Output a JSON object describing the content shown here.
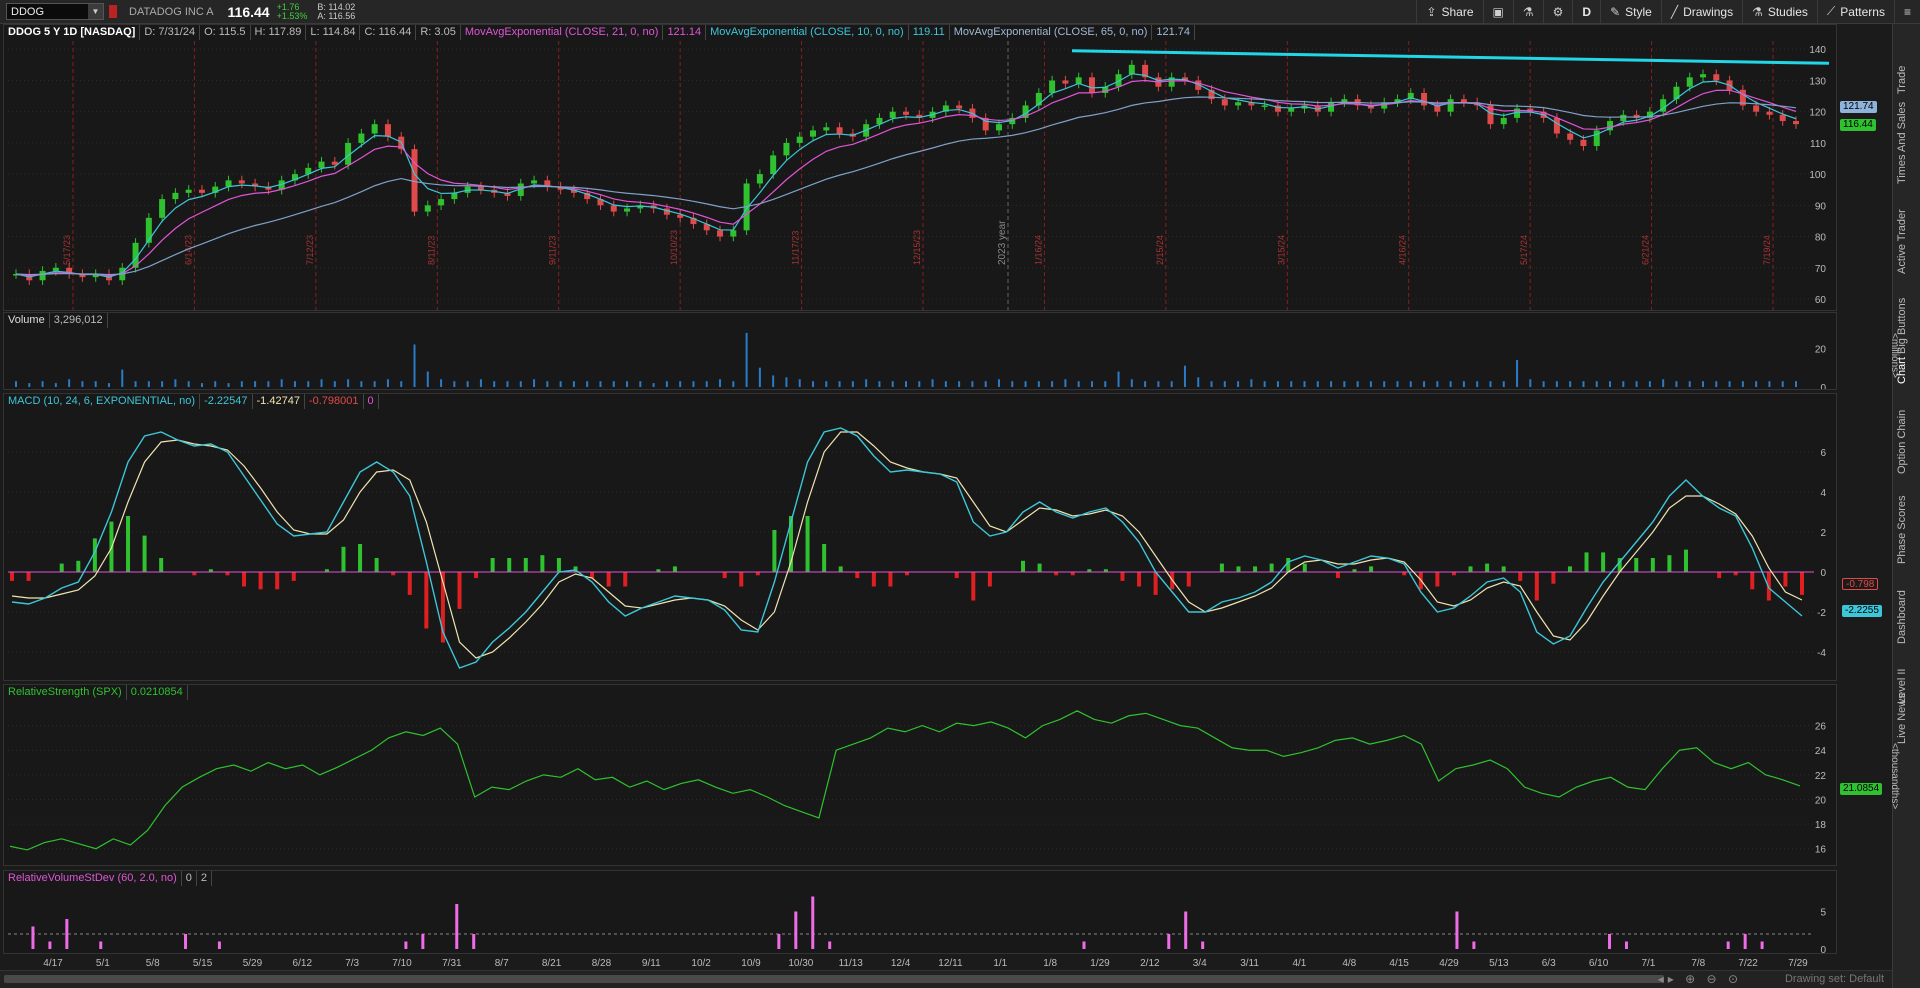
{
  "toolbar": {
    "symbol": "DDOG",
    "company": "DATADOG INC A",
    "last": "116.44",
    "change": "+1.76",
    "change_pct": "+1.53%",
    "bid": "B: 114.02",
    "ask": "A: 116.56",
    "share": "Share",
    "period": "D",
    "style": "Style",
    "drawings": "Drawings",
    "studies": "Studies",
    "patterns": "Patterns"
  },
  "side_tabs": [
    "Trade",
    "Times And Sales",
    "Active Trader",
    "Big Buttons",
    "Chart",
    "Option Chain",
    "Phase Scores",
    "Dashboard",
    "Level II",
    "Live News"
  ],
  "price_panel": {
    "header": "DDOG 5 Y 1D [NASDAQ]",
    "ohlc": {
      "d": "D: 7/31/24",
      "o": "O: 115.5",
      "h": "H: 117.89",
      "l": "L: 114.84",
      "c": "C: 116.44",
      "r": "R: 3.05"
    },
    "ema21_label": "MovAvgExponential (CLOSE, 21, 0, no)",
    "ema21_val": "121.14",
    "ema10_label": "MovAvgExponential (CLOSE, 10, 0, no)",
    "ema10_val": "119.11",
    "ema65_label": "MovAvgExponential (CLOSE, 65, 0, no)",
    "ema65_val": "121.74",
    "last_bubble": "116.44",
    "ema_bubble": "121.74",
    "year_marker": "2023 year",
    "colors": {
      "up": "#2fc12f",
      "down": "#e04a4a",
      "ema10": "#3cc6d8",
      "ema21": "#e155d7",
      "ema65": "#7fa1c8",
      "trendline": "#23d6e6"
    }
  },
  "volume_panel": {
    "label": "Volume",
    "value": "3,296,012",
    "unit": "<millions>"
  },
  "macd_panel": {
    "label": "MACD (10, 24, 6, EXPONENTIAL, no)",
    "value": "-2.22547",
    "avg": "-1.42747",
    "diff": "-0.798001",
    "zero": "0",
    "bubble_diff": "-0.798",
    "bubble_value": "-2.2255"
  },
  "rs_panel": {
    "label": "RelativeStrength (SPX)",
    "value": "0.0210854",
    "bubble": "21.0854",
    "unit": "<thousandths>"
  },
  "rv_panel": {
    "label": "RelativeVolumeStDev (60, 2.0, no)",
    "value": "0",
    "threshold": "2"
  },
  "x_axis": [
    "4/17",
    "5/1",
    "5/8",
    "5/15",
    "5/29",
    "6/12",
    "7/3",
    "7/10",
    "7/31",
    "8/7",
    "8/21",
    "8/28",
    "9/11",
    "10/2",
    "10/9",
    "10/30",
    "11/13",
    "12/4",
    "12/11",
    "1/1",
    "1/8",
    "1/29",
    "2/12",
    "3/4",
    "3/11",
    "4/1",
    "4/8",
    "4/15",
    "4/29",
    "5/13",
    "6/3",
    "6/10",
    "7/1",
    "7/8",
    "7/22",
    "7/29"
  ],
  "date_markers": [
    "5/17/23",
    "6/14/23",
    "7/12/23",
    "8/11/23",
    "9/11/23",
    "10/10/23",
    "11/17/23",
    "12/15/23",
    "1/16/24",
    "2/15/24",
    "3/15/24",
    "4/16/24",
    "5/17/24",
    "6/21/24",
    "7/19/24"
  ],
  "price_ticks": [
    "140",
    "130",
    "120",
    "110",
    "100",
    "90",
    "80",
    "70",
    "60"
  ],
  "volume_ticks": [
    "20",
    "0"
  ],
  "macd_ticks": [
    "6",
    "4",
    "2",
    "0",
    "-2",
    "-4"
  ],
  "rs_ticks": [
    "26",
    "24",
    "22",
    "20",
    "18",
    "16"
  ],
  "rv_ticks": [
    "5",
    "0"
  ],
  "chart_data": {
    "type": "line",
    "price_closes": [
      68,
      66,
      69,
      70,
      68,
      67,
      68,
      66,
      70,
      78,
      86,
      92,
      94,
      95,
      94,
      96,
      98,
      97,
      96,
      95,
      98,
      100,
      102,
      104,
      103,
      110,
      113,
      116,
      112,
      108,
      88,
      90,
      92,
      94,
      96,
      95,
      94,
      93,
      97,
      98,
      96,
      95,
      94,
      92,
      90,
      88,
      89,
      90,
      89,
      87,
      86,
      84,
      82,
      80,
      82,
      97,
      100,
      106,
      110,
      112,
      114,
      115,
      113,
      112,
      116,
      118,
      120,
      119,
      118,
      120,
      122,
      121,
      118,
      114,
      116,
      118,
      122,
      126,
      130,
      129,
      131,
      126,
      128,
      132,
      135,
      131,
      128,
      131,
      130,
      127,
      124,
      122,
      123,
      122,
      122,
      120,
      121,
      122,
      120,
      123,
      124,
      122,
      121,
      123,
      124,
      126,
      122,
      120,
      124,
      123,
      122,
      116,
      118,
      121,
      120,
      118,
      113,
      111,
      109,
      114,
      117,
      119,
      118,
      120,
      124,
      128,
      131,
      132,
      130,
      127,
      122,
      120,
      119,
      117,
      116
    ],
    "volume_millions": [
      3,
      2,
      3,
      2,
      4,
      3,
      3,
      2,
      9,
      3,
      3,
      3,
      4,
      3,
      2,
      3,
      2,
      3,
      3,
      3,
      4,
      3,
      3,
      4,
      3,
      4,
      3,
      3,
      4,
      3,
      22,
      8,
      4,
      3,
      3,
      4,
      3,
      3,
      3,
      4,
      3,
      3,
      3,
      3,
      3,
      3,
      3,
      3,
      2,
      3,
      3,
      3,
      3,
      4,
      3,
      28,
      10,
      6,
      5,
      4,
      3,
      3,
      3,
      3,
      4,
      3,
      3,
      3,
      3,
      4,
      3,
      3,
      3,
      3,
      4,
      3,
      3,
      3,
      3,
      4,
      3,
      3,
      3,
      8,
      4,
      3,
      3,
      3,
      11,
      5,
      3,
      3,
      3,
      4,
      3,
      3,
      3,
      3,
      3,
      3,
      3,
      3,
      3,
      3,
      3,
      3,
      3,
      3,
      3,
      3,
      3,
      3,
      3,
      14,
      4,
      3,
      3,
      3,
      3,
      3,
      3,
      3,
      3,
      3,
      4,
      3,
      3,
      3,
      3,
      3,
      3,
      3,
      3,
      3,
      3
    ],
    "macd_value": [
      -1.5,
      -1.6,
      -1.3,
      -0.8,
      -0.5,
      1.0,
      3.0,
      5.5,
      6.8,
      7.0,
      6.6,
      6.3,
      6.4,
      6.0,
      4.8,
      3.6,
      2.4,
      1.8,
      1.9,
      2.0,
      3.5,
      5.0,
      5.5,
      5.0,
      3.8,
      0.5,
      -3.0,
      -4.8,
      -4.5,
      -3.5,
      -2.8,
      -2.0,
      -1.0,
      0.0,
      0.1,
      -0.5,
      -1.5,
      -2.2,
      -1.8,
      -1.5,
      -1.2,
      -1.3,
      -1.4,
      -1.9,
      -2.9,
      -3.0,
      -0.5,
      2.5,
      5.5,
      7.0,
      7.2,
      6.8,
      5.8,
      5.0,
      5.1,
      5.0,
      4.9,
      4.5,
      2.5,
      1.8,
      2.0,
      3.0,
      3.5,
      3.0,
      2.7,
      3.0,
      3.2,
      2.5,
      1.5,
      0.0,
      -1.0,
      -2.0,
      -2.0,
      -1.5,
      -1.3,
      -1.0,
      -0.5,
      0.5,
      0.8,
      0.6,
      0.2,
      0.5,
      0.8,
      0.7,
      0.4,
      -1.0,
      -2.0,
      -1.8,
      -1.2,
      -0.5,
      -0.3,
      -1.0,
      -3.0,
      -3.6,
      -3.2,
      -1.8,
      -0.5,
      0.5,
      1.5,
      2.5,
      3.8,
      4.6,
      3.8,
      3.2,
      2.8,
      1.2,
      -0.8,
      -1.5,
      -2.2
    ],
    "macd_avg": [
      -1.2,
      -1.3,
      -1.3,
      -1.1,
      -0.9,
      -0.2,
      1.2,
      3.5,
      5.5,
      6.5,
      6.6,
      6.4,
      6.3,
      6.1,
      5.3,
      4.2,
      3.0,
      2.1,
      1.9,
      1.9,
      2.6,
      4.0,
      5.0,
      5.1,
      4.6,
      2.5,
      -0.5,
      -3.5,
      -4.3,
      -4.0,
      -3.3,
      -2.5,
      -1.6,
      -0.5,
      -0.1,
      -0.3,
      -1.0,
      -1.7,
      -1.8,
      -1.6,
      -1.4,
      -1.3,
      -1.4,
      -1.7,
      -2.4,
      -2.9,
      -2.0,
      0.5,
      3.5,
      6.0,
      7.0,
      7.0,
      6.3,
      5.5,
      5.2,
      5.0,
      4.9,
      4.7,
      3.5,
      2.3,
      2.0,
      2.6,
      3.2,
      3.1,
      2.8,
      2.9,
      3.1,
      2.8,
      2.0,
      0.8,
      -0.4,
      -1.5,
      -2.0,
      -1.8,
      -1.5,
      -1.2,
      -0.8,
      0.0,
      0.5,
      0.6,
      0.4,
      0.4,
      0.6,
      0.7,
      0.5,
      -0.4,
      -1.5,
      -1.7,
      -1.4,
      -0.8,
      -0.5,
      -0.7,
      -2.0,
      -3.2,
      -3.4,
      -2.5,
      -1.2,
      0.0,
      1.0,
      2.0,
      3.2,
      3.8,
      3.8,
      3.4,
      2.9,
      1.8,
      0.2,
      -1.0,
      -1.4
    ],
    "rs_thousandths": [
      16.2,
      15.9,
      16.5,
      16.8,
      16.4,
      16.0,
      16.8,
      16.3,
      17.5,
      19.5,
      21.0,
      21.8,
      22.5,
      22.8,
      22.3,
      23.0,
      22.5,
      22.8,
      22.0,
      22.6,
      23.3,
      24.0,
      25.0,
      25.5,
      25.2,
      25.8,
      24.5,
      20.2,
      21.0,
      20.8,
      21.5,
      22.0,
      21.8,
      22.5,
      21.6,
      21.8,
      21.0,
      21.5,
      20.8,
      21.3,
      21.6,
      21.0,
      20.5,
      20.8,
      20.2,
      19.5,
      19.0,
      18.5,
      24.0,
      24.5,
      25.0,
      25.8,
      25.5,
      26.0,
      25.5,
      26.2,
      26.0,
      26.3,
      25.8,
      25.0,
      26.0,
      26.5,
      27.2,
      26.5,
      26.2,
      26.8,
      27.0,
      26.5,
      26.0,
      25.8,
      25.0,
      24.2,
      24.0,
      24.0,
      23.5,
      23.8,
      24.2,
      24.8,
      25.0,
      24.5,
      24.8,
      25.2,
      24.5,
      21.5,
      22.5,
      22.8,
      23.2,
      22.5,
      21.0,
      20.5,
      20.2,
      21.0,
      21.5,
      21.8,
      21.0,
      20.8,
      22.5,
      24.0,
      24.2,
      23.0,
      22.5,
      23.0,
      22.0,
      21.6,
      21.1
    ],
    "relvol": [
      0,
      3,
      1,
      4,
      0,
      1,
      0,
      0,
      0,
      0,
      2,
      0,
      1,
      0,
      0,
      0,
      0,
      0,
      0,
      0,
      0,
      0,
      0,
      1,
      2,
      0,
      6,
      2,
      0,
      0,
      0,
      0,
      0,
      0,
      0,
      0,
      0,
      0,
      0,
      0,
      0,
      0,
      0,
      0,
      0,
      2,
      5,
      7,
      1,
      0,
      0,
      0,
      0,
      0,
      0,
      0,
      0,
      0,
      0,
      0,
      0,
      0,
      0,
      1,
      0,
      0,
      0,
      0,
      2,
      5,
      1,
      0,
      0,
      0,
      0,
      0,
      0,
      0,
      0,
      0,
      0,
      0,
      0,
      0,
      0,
      5,
      1,
      0,
      0,
      0,
      0,
      0,
      0,
      0,
      2,
      1,
      0,
      0,
      0,
      0,
      0,
      1,
      2,
      1,
      0,
      0
    ],
    "y_range_price": [
      60,
      142
    ],
    "y_range_macd": [
      -5,
      8
    ],
    "y_range_rs": [
      15,
      28
    ]
  }
}
